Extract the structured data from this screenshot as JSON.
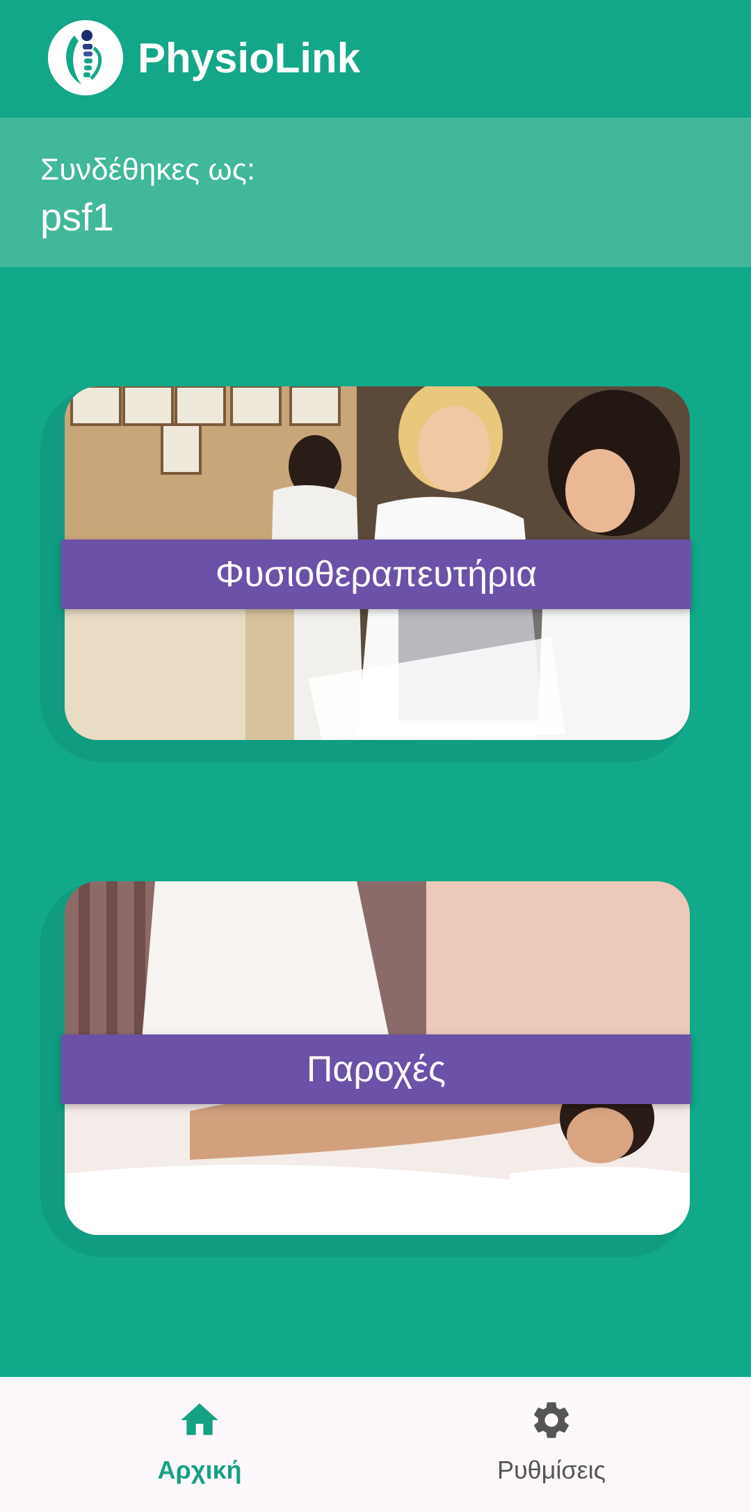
{
  "app": {
    "title": "PhysioLink",
    "logo_icon": "spine-logo-icon"
  },
  "user_panel": {
    "label": "Συνδέθηκες ως:",
    "username": "psf1"
  },
  "cards": [
    {
      "label": "Φυσιοθεραπευτήρια",
      "image": "clinic-photo"
    },
    {
      "label": "Παροχές",
      "image": "massage-photo"
    }
  ],
  "bottom_nav": {
    "items": [
      {
        "label": "Αρχική",
        "icon": "home-icon",
        "active": true
      },
      {
        "label": "Ρυθμίσεις",
        "icon": "gear-icon",
        "active": false
      }
    ]
  },
  "colors": {
    "primary": "#12a88a",
    "banner": "#6b51a8",
    "active_nav": "#15a184",
    "inactive_nav": "#555555"
  }
}
